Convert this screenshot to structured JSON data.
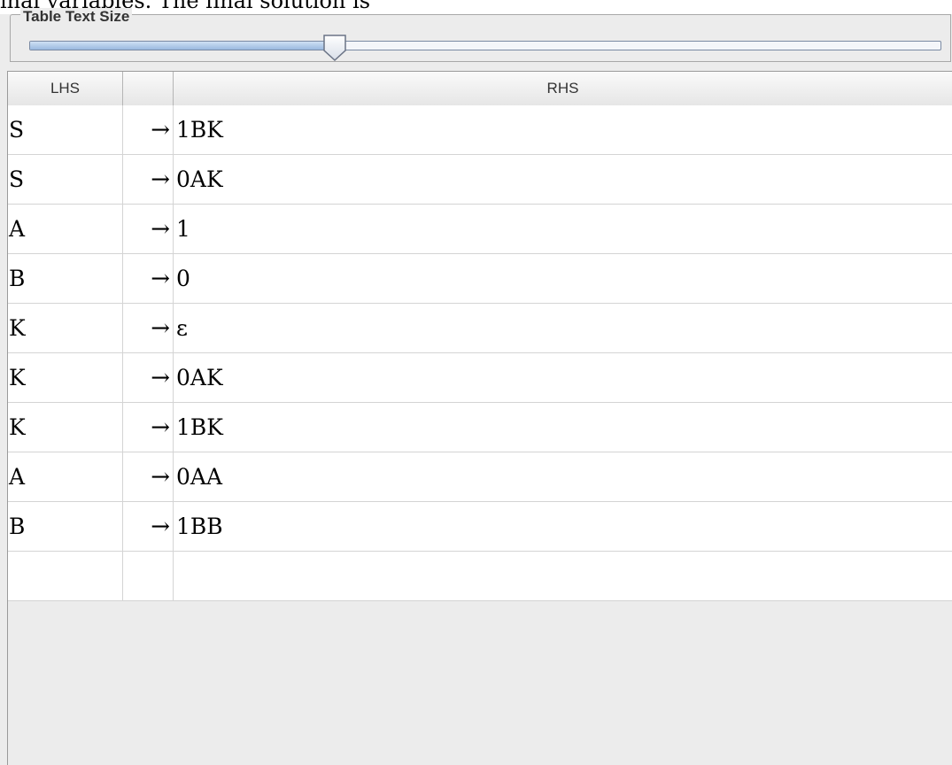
{
  "background_text": "inal variables. The final solution is",
  "text_size_panel": {
    "legend": "Table Text Size",
    "slider_value_fraction": 0.335
  },
  "table": {
    "columns": [
      "LHS",
      "",
      "RHS"
    ],
    "rows": [
      {
        "lhs": "S",
        "arrow": "→",
        "rhs": "1BK"
      },
      {
        "lhs": "S",
        "arrow": "→",
        "rhs": "0AK"
      },
      {
        "lhs": "A",
        "arrow": "→",
        "rhs": "1"
      },
      {
        "lhs": "B",
        "arrow": "→",
        "rhs": "0"
      },
      {
        "lhs": "K",
        "arrow": "→",
        "rhs": "ε"
      },
      {
        "lhs": "K",
        "arrow": "→",
        "rhs": "0AK"
      },
      {
        "lhs": "K",
        "arrow": "→",
        "rhs": "1BK"
      },
      {
        "lhs": "A",
        "arrow": "→",
        "rhs": "0AA"
      },
      {
        "lhs": "B",
        "arrow": "→",
        "rhs": "1BB"
      },
      {
        "lhs": "",
        "arrow": "",
        "rhs": ""
      }
    ]
  },
  "colors": {
    "panel_bg": "#ececec",
    "table_bg": "#ffffff",
    "slider_border": "#7a8aa3"
  }
}
